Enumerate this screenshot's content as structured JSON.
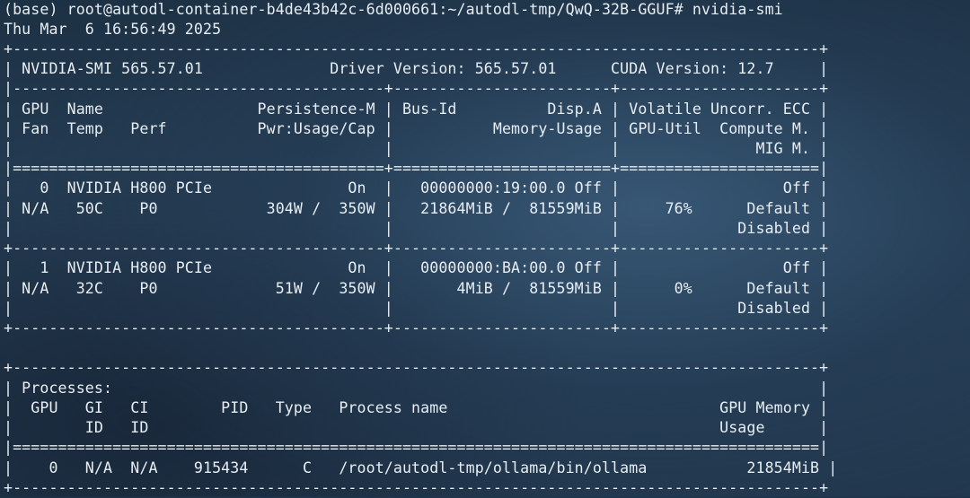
{
  "terminal": {
    "prompt": "(base) root@autodl-container-b4de43b42c-6d000661:~/autodl-tmp/QwQ-32B-GGUF#",
    "command": "nvidia-smi",
    "timestamp": "Thu Mar  6 16:56:49 2025",
    "lines": [
      "+-----------------------------------------------------------------------------------------+",
      "| NVIDIA-SMI 565.57.01              Driver Version: 565.57.01      CUDA Version: 12.7     |",
      "|-----------------------------------------+------------------------+----------------------+",
      "| GPU  Name                 Persistence-M | Bus-Id          Disp.A | Volatile Uncorr. ECC |",
      "| Fan  Temp   Perf          Pwr:Usage/Cap |           Memory-Usage | GPU-Util  Compute M. |",
      "|                                         |                        |               MIG M. |",
      "|=========================================+========================+======================|",
      "|   0  NVIDIA H800 PCIe               On  |   00000000:19:00.0 Off |                  Off |",
      "| N/A   50C    P0            304W /  350W |   21864MiB /  81559MiB |     76%      Default |",
      "|                                         |                        |             Disabled |",
      "+-----------------------------------------+------------------------+----------------------+",
      "|   1  NVIDIA H800 PCIe               On  |   00000000:BA:00.0 Off |                  Off |",
      "| N/A   32C    P0             51W /  350W |       4MiB /  81559MiB |      0%      Default |",
      "|                                         |                        |             Disabled |",
      "+-----------------------------------------+------------------------+----------------------+",
      "",
      "+-----------------------------------------------------------------------------------------+",
      "| Processes:                                                                              |",
      "|  GPU   GI   CI        PID   Type   Process name                              GPU Memory |",
      "|        ID   ID                                                               Usage      |",
      "|=========================================================================================|",
      "|    0   N/A  N/A    915434      C   /root/autodl-tmp/ollama/bin/ollama           21854MiB |",
      "+-----------------------------------------------------------------------------------------+"
    ]
  }
}
